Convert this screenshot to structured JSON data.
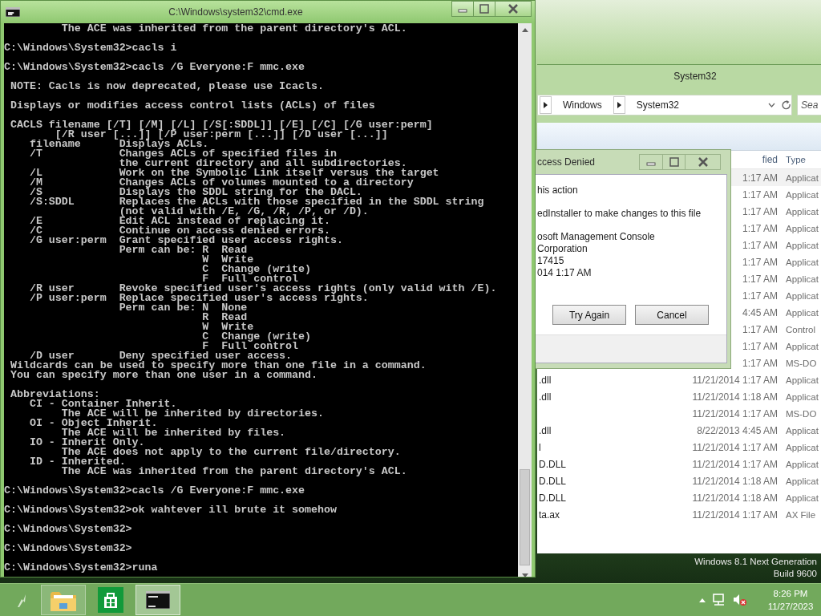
{
  "cmd_window": {
    "title": "C:\\Windows\\system32\\cmd.exe",
    "blocks": [
      [
        "         The ACE was inherited from the parent directory's ACL."
      ],
      [
        "C:\\Windows\\System32>cacls i"
      ],
      [
        "C:\\Windows\\System32>cacls /G Everyone:F mmc.exe"
      ],
      [
        " NOTE: Cacls is now deprecated, please use Icacls."
      ],
      [
        " Displays or modifies access control lists (ACLs) of files"
      ],
      [
        " CACLS filename [/T] [/M] [/L] [/S[:SDDL]] [/E] [/C] [/G user:perm]",
        "        [/R user [...]] [/P user:perm [...]] [/D user [...]]",
        "    filename      Displays ACLs.",
        "    /T            Changes ACLs of specified files in",
        "                  the current directory and all subdirectories.",
        "    /L            Work on the Symbolic Link itself versus the target",
        "    /M            Changes ACLs of volumes mounted to a directory",
        "    /S            Displays the SDDL string for the DACL.",
        "    /S:SDDL       Replaces the ACLs with those specified in the SDDL string",
        "                  (not valid with /E, /G, /R, /P, or /D).",
        "    /E            Edit ACL instead of replacing it.",
        "    /C            Continue on access denied errors.",
        "    /G user:perm  Grant specified user access rights.",
        "                  Perm can be: R  Read",
        "                               W  Write",
        "                               C  Change (write)",
        "                               F  Full control",
        "    /R user       Revoke specified user's access rights (only valid with /E).",
        "    /P user:perm  Replace specified user's access rights.",
        "                  Perm can be: N  None",
        "                               R  Read",
        "                               W  Write",
        "                               C  Change (write)",
        "                               F  Full control",
        "    /D user       Deny specified user access.",
        " Wildcards can be used to specify more than one file in a command.",
        " You can specify more than one user in a command."
      ],
      [
        " Abbreviations:",
        "    CI - Container Inherit.",
        "         The ACE will be inherited by directories.",
        "    OI - Object Inherit.",
        "         The ACE will be inherited by files.",
        "    IO - Inherit Only.",
        "         The ACE does not apply to the current file/directory.",
        "    ID - Inherited.",
        "         The ACE was inherited from the parent directory's ACL."
      ],
      [
        "C:\\Windows\\System32>cacls /G Everyone:F mmc.exe"
      ],
      [
        "C:\\Windows\\System32>ok wahtever ill brute it somehow"
      ],
      [
        "C:\\Windows\\System32>"
      ],
      [
        "C:\\Windows\\System32>"
      ],
      [
        "C:\\Windows\\System32>runa"
      ]
    ]
  },
  "explorer_window": {
    "title": "System32",
    "breadcrumbs": [
      "Windows",
      "System32"
    ],
    "search": {
      "placeholder": "Sea"
    },
    "columns": [
      "fied",
      "Type"
    ],
    "rows": [
      {
        "date": "1:17 AM",
        "type": "Applicat"
      },
      {
        "date": "1:17 AM",
        "type": "Applicat"
      },
      {
        "date": "1:17 AM",
        "type": "Applicat"
      },
      {
        "date": "1:17 AM",
        "type": "Applicat"
      },
      {
        "date": "1:17 AM",
        "type": "Applicat"
      },
      {
        "date": "1:17 AM",
        "type": "Applicat"
      },
      {
        "date": "1:17 AM",
        "type": "Applicat"
      },
      {
        "date": "1:17 AM",
        "type": "Applicat"
      },
      {
        "date": "4:45 AM",
        "type": "Applicat"
      },
      {
        "date": "1:17 AM",
        "type": "Control"
      },
      {
        "date": "1:17 AM",
        "type": "Applicat"
      },
      {
        "date": "1:17 AM",
        "type": "MS-DO"
      },
      {
        "name": ".dll",
        "date": "11/21/2014 1:17 AM",
        "type": "Applicat"
      },
      {
        "name": ".dll",
        "date": "11/21/2014 1:18 AM",
        "type": "Applicat"
      },
      {
        "date": "11/21/2014 1:17 AM",
        "type": "MS-DO"
      },
      {
        "name": ".dll",
        "date": "8/22/2013 4:45 AM",
        "type": "Applicat"
      },
      {
        "name": "l",
        "date": "11/21/2014 1:17 AM",
        "type": "Applicat"
      },
      {
        "name": "D.DLL",
        "date": "11/21/2014 1:17 AM",
        "type": "Applicat"
      },
      {
        "name": "D.DLL",
        "date": "11/21/2014 1:18 AM",
        "type": "Applicat"
      },
      {
        "name": "D.DLL",
        "date": "11/21/2014 1:18 AM",
        "type": "Applicat"
      },
      {
        "name": "ta.ax",
        "date": "11/21/2014 1:17 AM",
        "type": "AX File"
      }
    ]
  },
  "dialog": {
    "title": "ccess Denied",
    "paragraphs": [
      [
        "his action"
      ],
      [
        "edInstaller to make changes to this file"
      ],
      [
        "osoft Management Console",
        "Corporation",
        "17415",
        "014 1:17 AM"
      ]
    ],
    "buttons": [
      "Try Again",
      "Cancel"
    ]
  },
  "desktop": {
    "watermark": [
      "Windows 8.1 Next Generation",
      "Build 9600"
    ]
  },
  "taskbar": {
    "apps": [
      {
        "kind": "folder",
        "running": true,
        "selected": false
      },
      {
        "kind": "store",
        "running": false,
        "selected": false
      },
      {
        "kind": "console",
        "running": true,
        "selected": true
      }
    ],
    "clock": {
      "time": "8:26 PM",
      "date": "11/27/2023"
    }
  }
}
